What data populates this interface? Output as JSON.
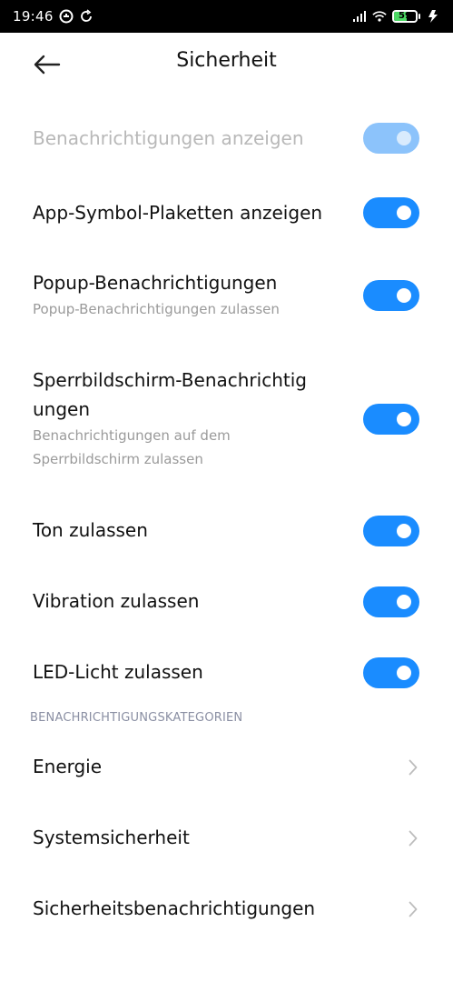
{
  "status_bar": {
    "time": "19:46",
    "battery_level": "59",
    "icons": [
      "notification-icon",
      "sync-icon",
      "signal-icon",
      "wifi-icon",
      "battery-icon",
      "charging-icon"
    ]
  },
  "header": {
    "title": "Sicherheit",
    "back_icon": "arrow-left-icon"
  },
  "settings": [
    {
      "title": "Benachrichtigungen anzeigen",
      "subtitle": "",
      "enabled": true,
      "disabled": true
    },
    {
      "title": "App-Symbol-Plaketten anzeigen",
      "subtitle": "",
      "enabled": true,
      "disabled": false
    },
    {
      "title": "Popup-Benachrichtigungen",
      "subtitle": "Popup-Benachrichtigungen zulassen",
      "enabled": true,
      "disabled": false
    },
    {
      "title_line1": "Sperrbildschirm-Benachrichtig",
      "title_line2": "ungen",
      "subtitle_line1": "Benachrichtigungen auf dem",
      "subtitle_line2": "Sperrbildschirm zulassen",
      "enabled": true,
      "disabled": false
    },
    {
      "title": "Ton zulassen",
      "subtitle": "",
      "enabled": true,
      "disabled": false
    },
    {
      "title": "Vibration zulassen",
      "subtitle": "",
      "enabled": true,
      "disabled": false
    },
    {
      "title": "LED-Licht zulassen",
      "subtitle": "",
      "enabled": true,
      "disabled": false
    }
  ],
  "categories_header": "BENACHRICHTIGUNGSKATEGORIEN",
  "categories": [
    {
      "label": "Energie"
    },
    {
      "label": "Systemsicherheit"
    },
    {
      "label": "Sicherheitsbenachrichtigungen"
    }
  ],
  "colors": {
    "accent": "#1a8cff",
    "accent_disabled": "#8cc3fb",
    "section_header": "#8a8fa3",
    "subtitle": "#9a9a9a"
  }
}
